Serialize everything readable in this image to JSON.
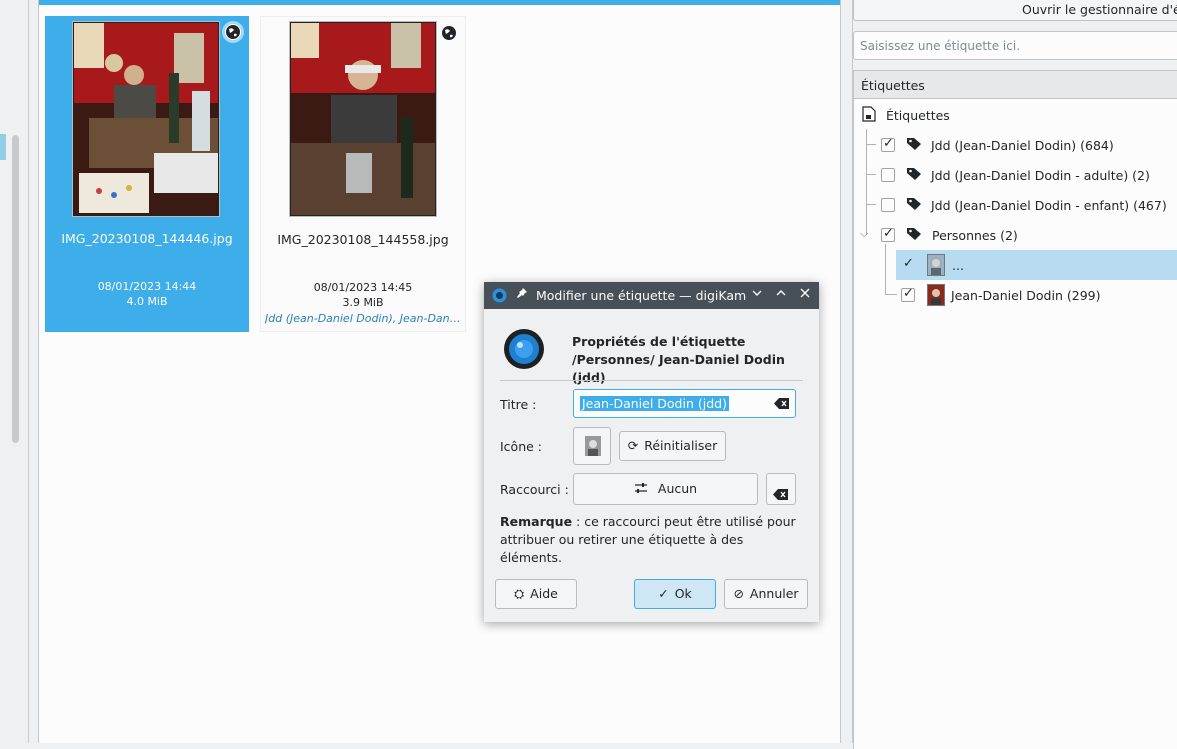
{
  "colors": {
    "accent": "#3daee9",
    "selection": "#b7dcf2",
    "titlebar": "#475057",
    "link": "#2980b9"
  },
  "thumbnails": [
    {
      "filename": "IMG_20230108_144446.jpg",
      "date": "08/01/2023 14:44",
      "size": "4.0 MiB",
      "tags": "",
      "selected": true,
      "geotag_icon": "globe-icon"
    },
    {
      "filename": "IMG_20230108_144558.jpg",
      "date": "08/01/2023 14:45",
      "size": "3.9 MiB",
      "tags": "Jdd (Jean-Daniel Dodin), Jean-Daniel ...",
      "selected": false,
      "geotag_icon": "globe-icon"
    }
  ],
  "right_panel": {
    "open_manager_label": "Ouvrir le gestionnaire d'ét",
    "tag_filter_placeholder": "Saisissez une étiquette ici.",
    "tags_header": "Étiquettes",
    "tree": {
      "root_label": "Étiquettes",
      "items": [
        {
          "label": "Jdd (Jean-Daniel Dodin) (684)",
          "checked": true
        },
        {
          "label": "Jdd (Jean-Daniel Dodin - adulte) (2)",
          "checked": false
        },
        {
          "label": "Jdd (Jean-Daniel Dodin - enfant) (467)",
          "checked": false
        },
        {
          "label": "Personnes (2)",
          "checked": true,
          "expanded": true
        },
        {
          "label": "...",
          "checked": true,
          "selected": true
        },
        {
          "label": "Jean-Daniel Dodin (299)",
          "checked": true
        }
      ]
    }
  },
  "dialog": {
    "title": "Modifier une étiquette — digiKam",
    "heading_line1": "Propriétés de l'étiquette",
    "heading_line2": "/Personnes/ Jean-Daniel Dodin (jdd)",
    "title_label": "Titre :",
    "title_value": "Jean-Daniel Dodin (jdd)",
    "icon_label": "Icône :",
    "reset_label": "Réinitialiser",
    "shortcut_label": "Raccourci :",
    "shortcut_value": "Aucun",
    "note_bold": "Remarque",
    "note_text": " : ce raccourci peut être utilisé pour attribuer ou retirer une étiquette à des éléments.",
    "help_label": "Aide",
    "ok_label": "Ok",
    "cancel_label": "Annuler"
  }
}
